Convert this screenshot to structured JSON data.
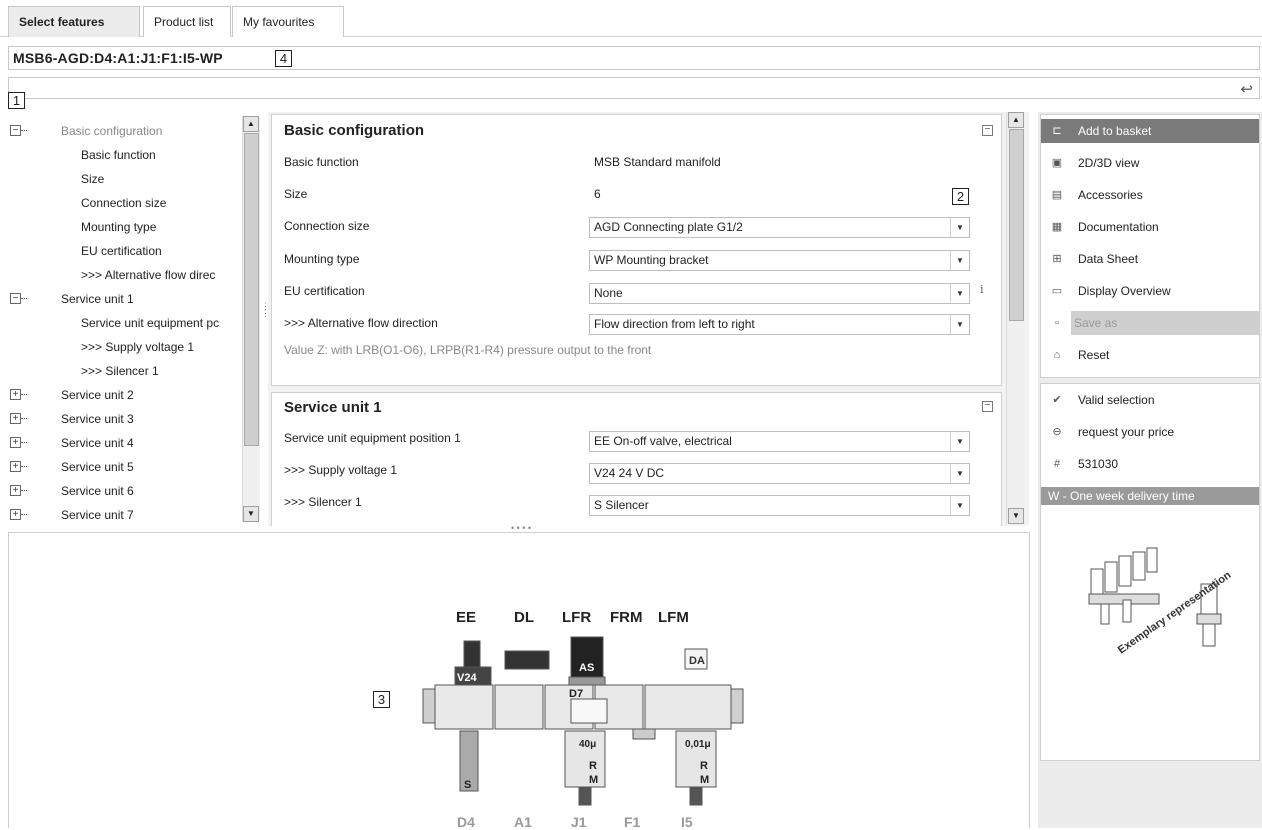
{
  "tabs": [
    "Select features",
    "Product list",
    "My favourites"
  ],
  "order_code": "MSB6-AGD:D4:A1:J1:F1:I5-WP",
  "markers": [
    "1",
    "2",
    "3",
    "4"
  ],
  "tree": {
    "items": [
      {
        "label": "Basic configuration",
        "level": 0,
        "toggle": "−"
      },
      {
        "label": "Basic function",
        "level": 1
      },
      {
        "label": "Size",
        "level": 1
      },
      {
        "label": "Connection size",
        "level": 1
      },
      {
        "label": "Mounting type",
        "level": 1
      },
      {
        "label": "EU certification",
        "level": 1
      },
      {
        "label": ">>> Alternative flow direc",
        "level": 1
      },
      {
        "label": "Service unit 1",
        "level": 0,
        "toggle": "−"
      },
      {
        "label": "Service unit equipment pc",
        "level": 1
      },
      {
        "label": ">>> Supply voltage 1",
        "level": 1
      },
      {
        "label": ">>> Silencer 1",
        "level": 1
      },
      {
        "label": "Service unit 2",
        "level": 0,
        "toggle": "+"
      },
      {
        "label": "Service unit 3",
        "level": 0,
        "toggle": "+"
      },
      {
        "label": "Service unit 4",
        "level": 0,
        "toggle": "+"
      },
      {
        "label": "Service unit 5",
        "level": 0,
        "toggle": "+"
      },
      {
        "label": "Service unit 6",
        "level": 0,
        "toggle": "+"
      },
      {
        "label": "Service unit 7",
        "level": 0,
        "toggle": "+"
      }
    ]
  },
  "basic_config": {
    "title": "Basic configuration",
    "basic_function_label": "Basic function",
    "basic_function_value": "MSB Standard manifold",
    "size_label": "Size",
    "size_value": "6",
    "connection_label": "Connection size",
    "connection_value": "AGD Connecting plate G1/2",
    "mounting_label": "Mounting type",
    "mounting_value": "WP Mounting bracket",
    "eu_label": "EU certification",
    "eu_value": "None",
    "info_icon": "i",
    "flow_label": ">>> Alternative flow direction",
    "flow_value": "Flow direction from left to right",
    "note": "Value Z: with LRB(O1-O6), LRPB(R1-R4) pressure output to the front"
  },
  "service_unit_1": {
    "title": "Service unit 1",
    "position_label": "Service unit equipment position 1",
    "position_value": "EE On-off valve, electrical",
    "voltage_label": ">>> Supply voltage 1",
    "voltage_value": "V24 24 V DC",
    "silencer_label": ">>> Silencer 1",
    "silencer_value": "S Silencer"
  },
  "actions": [
    {
      "icon": "basket-icon",
      "glyph": "⊏",
      "label": "Add to basket"
    },
    {
      "icon": "cad-icon",
      "glyph": "▣",
      "label": "2D/3D view"
    },
    {
      "icon": "accessories-icon",
      "glyph": "▤",
      "label": "Accessories"
    },
    {
      "icon": "pdf-icon",
      "glyph": "▦",
      "label": "Documentation"
    },
    {
      "icon": "table-icon",
      "glyph": "⊞",
      "label": "Data Sheet"
    },
    {
      "icon": "monitor-icon",
      "glyph": "▭",
      "label": "Display Overview"
    },
    {
      "icon": "save-icon",
      "glyph": "▫",
      "label": "Save as"
    },
    {
      "icon": "trash-icon",
      "glyph": "⌂",
      "label": "Reset"
    }
  ],
  "status": {
    "valid": "Valid selection",
    "price": "request your price",
    "part_number_symbol": "#",
    "part_number": "531030",
    "delivery": "W - One week delivery time"
  },
  "exemplary_text": "Exemplary representation",
  "diagram": {
    "modules": [
      "EE",
      "DL",
      "LFR",
      "FRM",
      "LFM"
    ],
    "bottom_codes": [
      "D4",
      "A1",
      "J1",
      "F1",
      "I5"
    ],
    "inner": {
      "v24": "V24",
      "as": "AS",
      "d7": "D7",
      "da": "DA",
      "f40": "40μ",
      "f001": "0,01μ",
      "r": "R",
      "m": "M",
      "s": "S"
    }
  },
  "colors": {
    "primary_action": "#7a7a7a",
    "delivery_bar": "#9a9a9a",
    "disabled": "#cfcfcf",
    "note_text": "#888888"
  }
}
